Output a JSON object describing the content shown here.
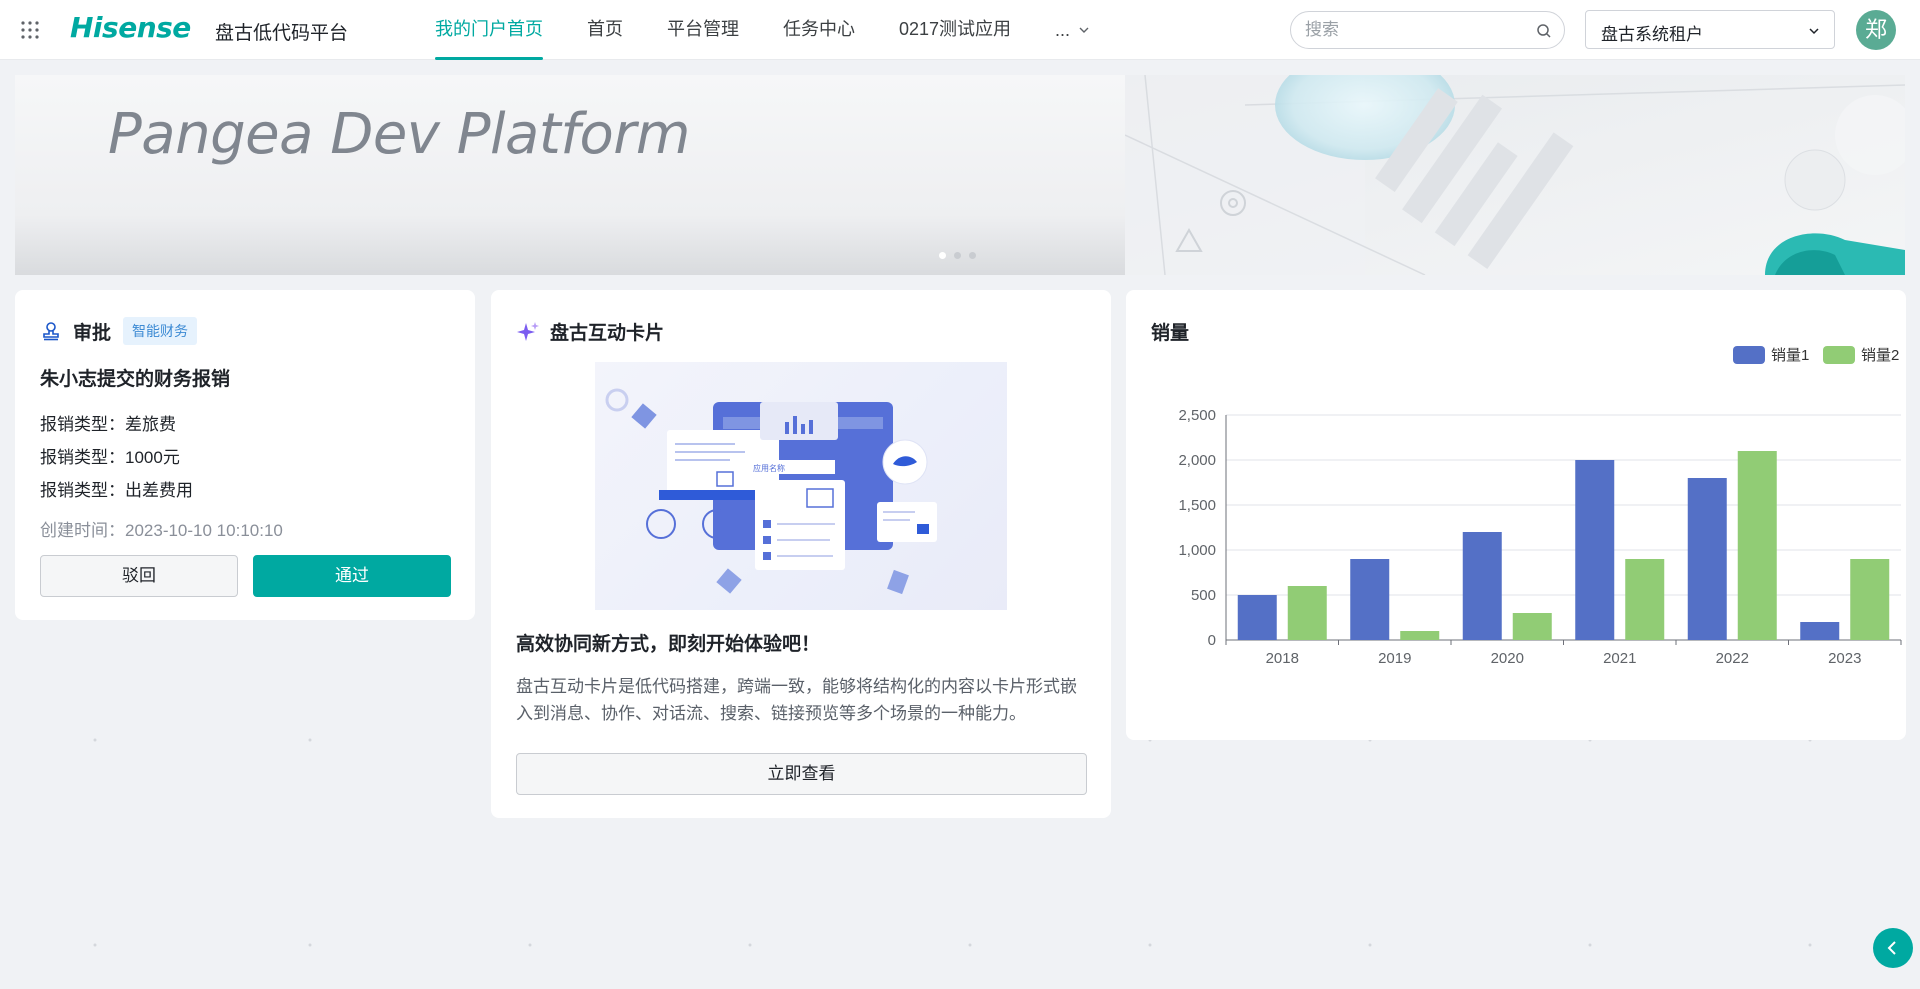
{
  "header": {
    "logo": "Hisense",
    "platform_name": "盘古低代码平台",
    "nav": [
      {
        "label": "我的门户首页",
        "active": true
      },
      {
        "label": "首页"
      },
      {
        "label": "平台管理"
      },
      {
        "label": "任务中心"
      },
      {
        "label": "0217测试应用"
      },
      {
        "label": "..."
      }
    ],
    "search": {
      "placeholder": "搜索",
      "value": ""
    },
    "tenant": "盘古系统租户",
    "avatar_text": "郑"
  },
  "banner": {
    "title": "Pangea Dev Platform",
    "dots": 3,
    "active_dot": 0
  },
  "approval_card": {
    "title": "审批",
    "tag": "智能财务",
    "subject": "朱小志提交的财务报销",
    "fields": [
      {
        "label": "报销类型：",
        "value": "差旅费"
      },
      {
        "label": "报销类型：",
        "value": "1000元"
      },
      {
        "label": "报销类型：",
        "value": "出差费用"
      }
    ],
    "created": {
      "label": "创建时间：",
      "value": "2023-10-10 10:10:10"
    },
    "reject_label": "驳回",
    "pass_label": "通过"
  },
  "interactive_card": {
    "title": "盘古互动卡片",
    "illustration_label": "应用名称",
    "headline": "高效协同新方式，即刻开始体验吧！",
    "description": "盘古互动卡片是低代码搭建，跨端一致，能够将结构化的内容以卡片形式嵌入到消息、协作、对话流、搜索、链接预览等多个场景的一种能力。",
    "button_label": "立即查看"
  },
  "sales_card": {
    "title": "销量"
  },
  "chart_data": {
    "type": "bar",
    "title": "销量",
    "categories": [
      "2018",
      "2019",
      "2020",
      "2021",
      "2022",
      "2023"
    ],
    "series": [
      {
        "name": "销量1",
        "values": [
          500,
          900,
          1200,
          2000,
          1800,
          200
        ],
        "color": "#5470c6"
      },
      {
        "name": "销量2",
        "values": [
          600,
          100,
          300,
          900,
          2100,
          900
        ],
        "color": "#91cc75"
      }
    ],
    "ylim": [
      0,
      2500
    ],
    "yticks": [
      "0",
      "500",
      "1,000",
      "1,500",
      "2,000",
      "2,500"
    ],
    "grid": true,
    "legend": "top-right"
  },
  "colors": {
    "accent": "#00a9a1",
    "tag_bg": "#e6f2fd",
    "tag_text": "#3d8bd4"
  }
}
